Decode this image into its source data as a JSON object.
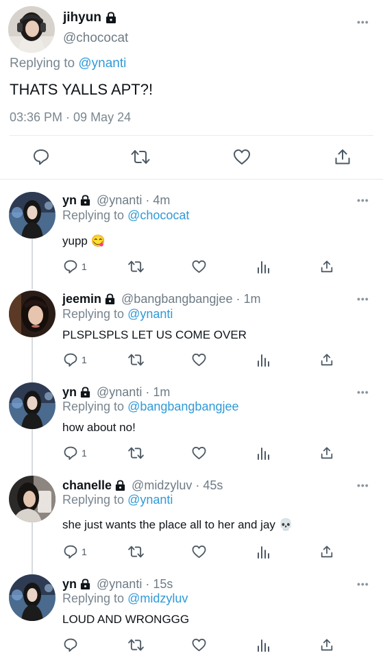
{
  "main_tweet": {
    "name": "jihyun",
    "handle": "@chococat",
    "replying_prefix": "Replying to",
    "replying_to": "@ynanti",
    "text": "THATS YALLS APT?!",
    "timestamp": "03:36 PM · 09 May 24"
  },
  "replies": [
    {
      "name": "yn",
      "handle_time": "@ynanti · 4m",
      "replying_prefix": "Replying to",
      "replying_to": "@chococat",
      "text": "yupp 😋",
      "reply_count": "1"
    },
    {
      "name": "jeemin",
      "handle_time": "@bangbangbangjee · 1m",
      "replying_prefix": "Replying to",
      "replying_to": "@ynanti",
      "text": "PLSPLSPLS LET US COME OVER",
      "reply_count": "1"
    },
    {
      "name": "yn",
      "handle_time": "@ynanti · 1m",
      "replying_prefix": "Replying to",
      "replying_to": "@bangbangbangjee",
      "text": "how about no!",
      "reply_count": "1"
    },
    {
      "name": "chanelle",
      "handle_time": "@midzyluv · 45s",
      "replying_prefix": "Replying to",
      "replying_to": "@ynanti",
      "text": "she just wants the place all to her and jay 💀",
      "reply_count": "1"
    },
    {
      "name": "yn",
      "handle_time": "@ynanti · 15s",
      "replying_prefix": "Replying to",
      "replying_to": "@midzyluv",
      "text": "LOUD AND WRONGGG",
      "reply_count": ""
    }
  ],
  "more_label": "•••",
  "colors": {
    "link": "#2f9ad8",
    "muted": "#6e7b85",
    "icon": "#4c5964"
  },
  "icons": [
    "lock-icon",
    "reply-icon",
    "retweet-icon",
    "like-icon",
    "views-icon",
    "share-icon",
    "more-icon"
  ]
}
